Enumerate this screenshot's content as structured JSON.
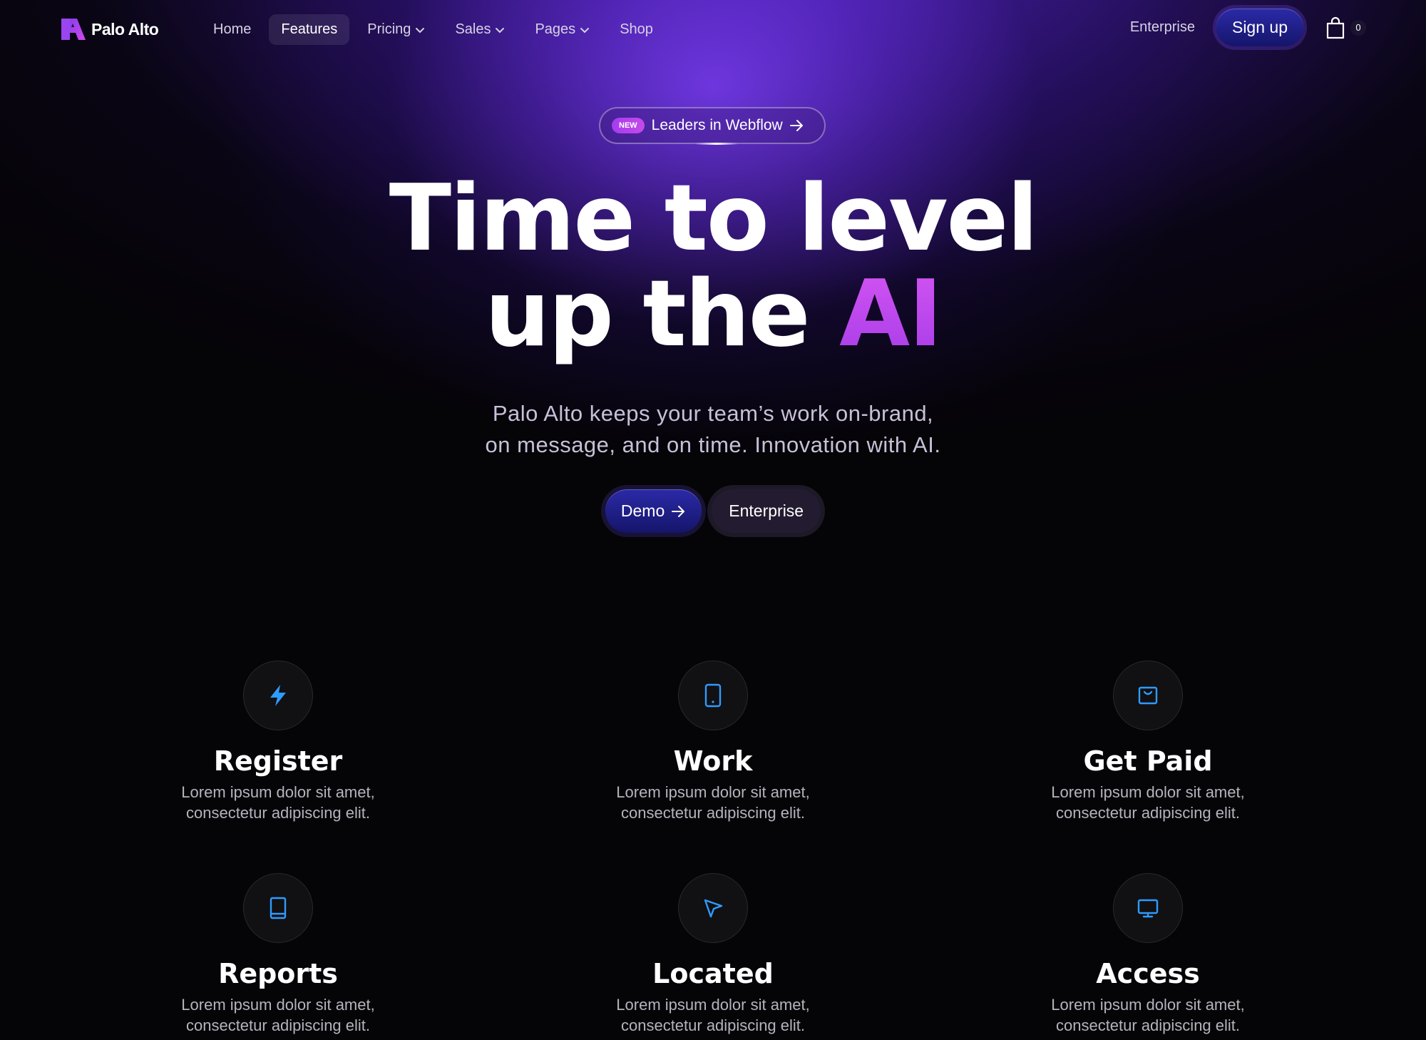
{
  "brand": {
    "name": "Palo Alto"
  },
  "nav": {
    "items": [
      {
        "label": "Home",
        "dropdown": false,
        "active": false
      },
      {
        "label": "Features",
        "dropdown": false,
        "active": true
      },
      {
        "label": "Pricing",
        "dropdown": true,
        "active": false
      },
      {
        "label": "Sales",
        "dropdown": true,
        "active": false
      },
      {
        "label": "Pages",
        "dropdown": true,
        "active": false
      },
      {
        "label": "Shop",
        "dropdown": false,
        "active": false
      }
    ],
    "enterprise_label": "Enterprise",
    "signup_label": "Sign up",
    "cart_count": "0"
  },
  "hero": {
    "badge": "NEW",
    "pill_text": "Leaders in Webflow",
    "headline_line1": "Time to level",
    "headline_line2_prefix": "up the ",
    "headline_accent": "AI",
    "sub_line1": "Palo Alto keeps your team’s work on-brand,",
    "sub_line2": "on message, and on time. Innovation with AI.",
    "demo_label": "Demo",
    "enterprise_label": "Enterprise"
  },
  "colors": {
    "accent_purple": "#6a33e8",
    "icon_blue": "#2f9bff",
    "ai_gradient_start": "#d655f2",
    "button_blue": "#2b2aa8"
  },
  "features": [
    {
      "icon": "lightning-icon",
      "title": "Register",
      "desc1": "Lorem ipsum dolor sit amet,",
      "desc2": "consectetur adipiscing elit."
    },
    {
      "icon": "tablet-icon",
      "title": "Work",
      "desc1": "Lorem ipsum dolor sit amet,",
      "desc2": "consectetur adipiscing elit."
    },
    {
      "icon": "wallet-icon",
      "title": "Get Paid",
      "desc1": "Lorem ipsum dolor sit amet,",
      "desc2": "consectetur adipiscing elit."
    },
    {
      "icon": "book-icon",
      "title": "Reports",
      "desc1": "Lorem ipsum dolor sit amet,",
      "desc2": "consectetur adipiscing elit."
    },
    {
      "icon": "pointer-icon",
      "title": "Located",
      "desc1": "Lorem ipsum dolor sit amet,",
      "desc2": "consectetur adipiscing elit."
    },
    {
      "icon": "monitor-icon",
      "title": "Access",
      "desc1": "Lorem ipsum dolor sit amet,",
      "desc2": "consectetur adipiscing elit."
    }
  ]
}
